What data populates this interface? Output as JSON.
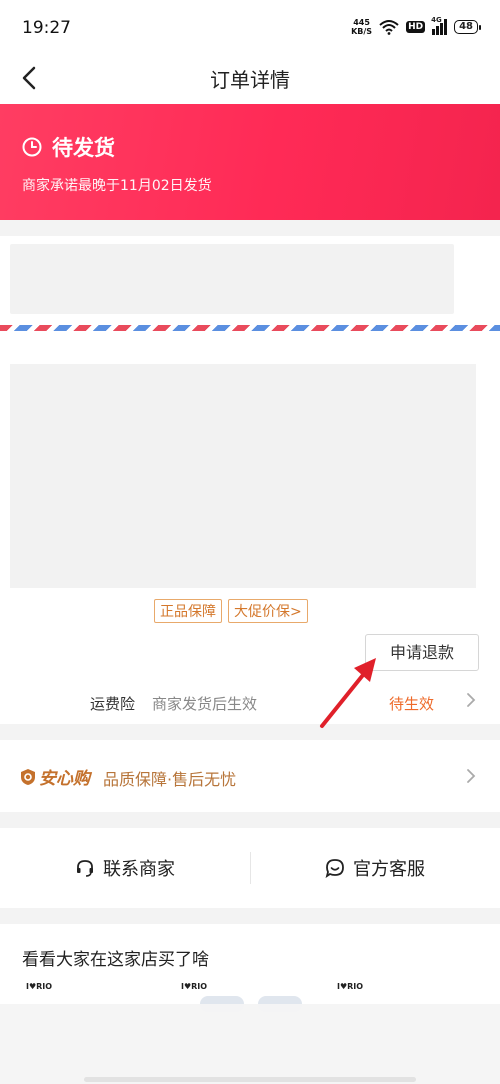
{
  "status_bar": {
    "time": "19:27",
    "net_speed_value": "445",
    "net_speed_unit": "KB/S",
    "hd_badge": "HD",
    "network": "4G",
    "battery": "48"
  },
  "nav": {
    "title": "订单详情",
    "back_icon": "chevron-left-icon"
  },
  "order_status": {
    "icon": "clock-icon",
    "title": "待发货",
    "subtitle": "商家承诺最晚于11月02日发货",
    "gradient_colors": [
      "#ff3d62",
      "#f4244e"
    ]
  },
  "product": {
    "tags": [
      "正品保障",
      "大促价保>"
    ],
    "refund_button": "申请退款"
  },
  "shipping_insurance": {
    "label": "运费险",
    "description": "商家发货后生效",
    "status": "待生效",
    "status_color": "#ee6a2a"
  },
  "guarantee": {
    "brand": "安心购",
    "text": "品质保障·售后无忧",
    "color": "#c4712c"
  },
  "contact": {
    "merchant": "联系商家",
    "official": "官方客服"
  },
  "recommendations": {
    "title": "看看大家在这家店买了啥",
    "brand_logo_text": "I♥RIO"
  },
  "annotation": {
    "arrow_color": "#e0202a"
  }
}
